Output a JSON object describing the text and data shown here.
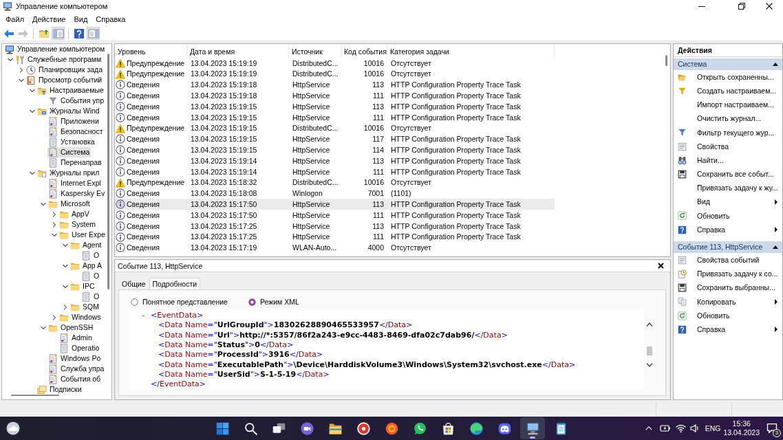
{
  "window": {
    "title": "Управление компьютером"
  },
  "menu": [
    "Файл",
    "Действие",
    "Вид",
    "Справка"
  ],
  "toolbar": [
    {
      "kind": "back",
      "disabled": false,
      "pressed": false
    },
    {
      "kind": "forward",
      "disabled": true,
      "pressed": false
    },
    {
      "kind": "separator"
    },
    {
      "kind": "up",
      "disabled": false,
      "pressed": false
    },
    {
      "kind": "tree",
      "disabled": false,
      "pressed": true
    },
    {
      "kind": "separator"
    },
    {
      "kind": "help",
      "disabled": false,
      "pressed": false
    },
    {
      "kind": "actions",
      "disabled": false,
      "pressed": true
    }
  ],
  "tree": [
    {
      "label": "Управление компьютером",
      "kind": "computer",
      "selected": false,
      "children": [
        {
          "label": "Служебные программ",
          "kind": "tools",
          "expanded": true,
          "selected": false,
          "children": [
            {
              "label": "Планировщик зада",
              "kind": "clock",
              "expanded": false,
              "selected": false
            },
            {
              "label": "Просмотр событий",
              "kind": "viewer",
              "expanded": true,
              "selected": false,
              "children": [
                {
                  "label": "Настраиваемые",
                  "kind": "filterfolder",
                  "expanded": true,
                  "selected": false,
                  "children": [
                    {
                      "label": "События упр",
                      "kind": "funnel",
                      "selected": false
                    }
                  ]
                },
                {
                  "label": "Журналы Wind",
                  "kind": "logfolder",
                  "expanded": true,
                  "selected": false,
                  "children": [
                    {
                      "label": "Приложени",
                      "kind": "eventlog",
                      "selected": false
                    },
                    {
                      "label": "Безопасност",
                      "kind": "eventlog",
                      "selected": false
                    },
                    {
                      "label": "Установка",
                      "kind": "plainlog",
                      "selected": false
                    },
                    {
                      "label": "Система",
                      "kind": "eventlog",
                      "selected": true
                    },
                    {
                      "label": "Перенаправ",
                      "kind": "plainlog",
                      "selected": false
                    }
                  ]
                },
                {
                  "label": "Журналы прил",
                  "kind": "appfolder",
                  "expanded": true,
                  "selected": false,
                  "children": [
                    {
                      "label": "Internet Expl",
                      "kind": "eventlog",
                      "selected": false
                    },
                    {
                      "label": "Kaspersky Ev",
                      "kind": "eventlog",
                      "selected": false
                    },
                    {
                      "label": "Microsoft",
                      "kind": "folder",
                      "expanded": true,
                      "selected": false,
                      "children": [
                        {
                          "label": "AppV",
                          "kind": "folder",
                          "expanded": false,
                          "selected": false
                        },
                        {
                          "label": "System",
                          "kind": "folder",
                          "expanded": false,
                          "selected": false
                        },
                        {
                          "label": "User Expe",
                          "kind": "folder",
                          "expanded": true,
                          "selected": false,
                          "children": [
                            {
                              "label": "Agent",
                              "kind": "folder",
                              "expanded": true,
                              "selected": false,
                              "children": [
                                {
                                  "label": "O",
                                  "kind": "plainlog",
                                  "selected": false
                                }
                              ]
                            },
                            {
                              "label": "App A",
                              "kind": "folder",
                              "expanded": true,
                              "selected": false,
                              "children": [
                                {
                                  "label": "O",
                                  "kind": "plainlog",
                                  "selected": false
                                }
                              ]
                            },
                            {
                              "label": "IPC",
                              "kind": "folder",
                              "expanded": true,
                              "selected": false,
                              "children": [
                                {
                                  "label": "O",
                                  "kind": "plainlog",
                                  "selected": false
                                }
                              ]
                            },
                            {
                              "label": "SQM",
                              "kind": "folder",
                              "expanded": false,
                              "selected": false
                            }
                          ]
                        },
                        {
                          "label": "Windows",
                          "kind": "folder",
                          "expanded": false,
                          "selected": false
                        }
                      ]
                    },
                    {
                      "label": "OpenSSH",
                      "kind": "folder",
                      "expanded": true,
                      "selected": false,
                      "children": [
                        {
                          "label": "Admin",
                          "kind": "eventlog",
                          "selected": false
                        },
                        {
                          "label": "Operatio",
                          "kind": "plainlog",
                          "selected": false
                        }
                      ]
                    },
                    {
                      "label": "Windows Po",
                      "kind": "eventlog",
                      "selected": false
                    },
                    {
                      "label": "Служба упра",
                      "kind": "eventlog",
                      "selected": false
                    },
                    {
                      "label": "События об",
                      "kind": "eventlog",
                      "selected": false
                    }
                  ]
                },
                {
                  "label": "Подписки",
                  "kind": "subscriptions",
                  "selected": false
                }
              ]
            }
          ]
        }
      ]
    }
  ],
  "events": {
    "columns": [
      "Уровень",
      "Дата и время",
      "Источник",
      "Код события",
      "Категория задачи"
    ],
    "rows": [
      {
        "kind": "warning",
        "severity": "Предупреждение",
        "date": "13.04.2023 15:19:19",
        "source": "DistributedC...",
        "event_id": "10016",
        "category": "Отсутствует",
        "selected": false
      },
      {
        "kind": "warning",
        "severity": "Предупреждение",
        "date": "13.04.2023 15:19:19",
        "source": "DistributedC...",
        "event_id": "10016",
        "category": "Отсутствует",
        "selected": false
      },
      {
        "kind": "info",
        "severity": "Сведения",
        "date": "13.04.2023 15:19:18",
        "source": "HttpService",
        "event_id": "113",
        "category": "HTTP Configuration Property Trace Task",
        "selected": false
      },
      {
        "kind": "info",
        "severity": "Сведения",
        "date": "13.04.2023 15:19:18",
        "source": "HttpService",
        "event_id": "111",
        "category": "HTTP Configuration Property Trace Task",
        "selected": false
      },
      {
        "kind": "info",
        "severity": "Сведения",
        "date": "13.04.2023 15:19:15",
        "source": "HttpService",
        "event_id": "113",
        "category": "HTTP Configuration Property Trace Task",
        "selected": false
      },
      {
        "kind": "info",
        "severity": "Сведения",
        "date": "13.04.2023 15:19:15",
        "source": "HttpService",
        "event_id": "111",
        "category": "HTTP Configuration Property Trace Task",
        "selected": false
      },
      {
        "kind": "warning",
        "severity": "Предупреждение",
        "date": "13.04.2023 15:19:15",
        "source": "DistributedC...",
        "event_id": "10016",
        "category": "Отсутствует",
        "selected": false
      },
      {
        "kind": "info",
        "severity": "Сведения",
        "date": "13.04.2023 15:19:15",
        "source": "HttpService",
        "event_id": "117",
        "category": "HTTP Configuration Property Trace Task",
        "selected": false
      },
      {
        "kind": "info",
        "severity": "Сведения",
        "date": "13.04.2023 15:19:15",
        "source": "HttpService",
        "event_id": "114",
        "category": "HTTP Configuration Property Trace Task",
        "selected": false
      },
      {
        "kind": "info",
        "severity": "Сведения",
        "date": "13.04.2023 15:19:14",
        "source": "HttpService",
        "event_id": "113",
        "category": "HTTP Configuration Property Trace Task",
        "selected": false
      },
      {
        "kind": "info",
        "severity": "Сведения",
        "date": "13.04.2023 15:19:14",
        "source": "HttpService",
        "event_id": "111",
        "category": "HTTP Configuration Property Trace Task",
        "selected": false
      },
      {
        "kind": "warning",
        "severity": "Предупреждение",
        "date": "13.04.2023 15:18:32",
        "source": "DistributedC...",
        "event_id": "10016",
        "category": "Отсутствует",
        "selected": false
      },
      {
        "kind": "info",
        "severity": "Сведения",
        "date": "13.04.2023 15:18:08",
        "source": "Winlogon",
        "event_id": "7001",
        "category": "(1101)",
        "selected": false
      },
      {
        "kind": "info",
        "severity": "Сведения",
        "date": "13.04.2023 15:17:50",
        "source": "HttpService",
        "event_id": "113",
        "category": "HTTP Configuration Property Trace Task",
        "selected": true
      },
      {
        "kind": "info",
        "severity": "Сведения",
        "date": "13.04.2023 15:17:50",
        "source": "HttpService",
        "event_id": "111",
        "category": "HTTP Configuration Property Trace Task",
        "selected": false
      },
      {
        "kind": "info",
        "severity": "Сведения",
        "date": "13.04.2023 15:17:25",
        "source": "HttpService",
        "event_id": "113",
        "category": "HTTP Configuration Property Trace Task",
        "selected": false
      },
      {
        "kind": "info",
        "severity": "Сведения",
        "date": "13.04.2023 15:17:25",
        "source": "HttpService",
        "event_id": "111",
        "category": "HTTP Configuration Property Trace Task",
        "selected": false
      },
      {
        "kind": "info",
        "severity": "Сведения",
        "date": "13.04.2023 15:17:19",
        "source": "WLAN-Auto...",
        "event_id": "4000",
        "category": "Отсутствует",
        "selected": false
      }
    ]
  },
  "details": {
    "title": "Событие 113, HttpService",
    "tabs": [
      {
        "label": "Общие",
        "selected": false
      },
      {
        "label": "Подробности",
        "selected": true
      }
    ],
    "view_modes": [
      {
        "label": "Понятное представление",
        "selected": false
      },
      {
        "label": "Режим XML",
        "selected": true
      }
    ],
    "xml": {
      "toggle": "-",
      "expanded": true,
      "parts": [
        {
          "kind": "punct",
          "text": "<"
        },
        {
          "kind": "tag",
          "text": "EventData"
        },
        {
          "kind": "punct",
          "text": ">"
        }
      ],
      "children": [
        {
          "parts": [
            {
              "kind": "punct",
              "text": "<"
            },
            {
              "kind": "tag",
              "text": "Data"
            },
            {
              "kind": "attr",
              "text": " Name"
            },
            {
              "kind": "punct",
              "text": "=\""
            },
            {
              "kind": "value",
              "text": "UrlGroupId"
            },
            {
              "kind": "punct",
              "text": "\">"
            },
            {
              "kind": "value",
              "text": "18302628890465533957"
            },
            {
              "kind": "punct",
              "text": "</"
            },
            {
              "kind": "tag",
              "text": "Data"
            },
            {
              "kind": "punct",
              "text": ">"
            }
          ]
        },
        {
          "parts": [
            {
              "kind": "punct",
              "text": "<"
            },
            {
              "kind": "tag",
              "text": "Data"
            },
            {
              "kind": "attr",
              "text": " Name"
            },
            {
              "kind": "punct",
              "text": "=\""
            },
            {
              "kind": "value",
              "text": "Url"
            },
            {
              "kind": "punct",
              "text": "\">"
            },
            {
              "kind": "value",
              "text": "http://*:5357/86f2a243-e9cc-4483-8469-dfa02c7dab96/"
            },
            {
              "kind": "punct",
              "text": "</"
            },
            {
              "kind": "tag",
              "text": "Data"
            },
            {
              "kind": "punct",
              "text": ">"
            }
          ]
        },
        {
          "parts": [
            {
              "kind": "punct",
              "text": "<"
            },
            {
              "kind": "tag",
              "text": "Data"
            },
            {
              "kind": "attr",
              "text": " Name"
            },
            {
              "kind": "punct",
              "text": "=\""
            },
            {
              "kind": "value",
              "text": "Status"
            },
            {
              "kind": "punct",
              "text": "\">"
            },
            {
              "kind": "value",
              "text": "0"
            },
            {
              "kind": "punct",
              "text": "</"
            },
            {
              "kind": "tag",
              "text": "Data"
            },
            {
              "kind": "punct",
              "text": ">"
            }
          ]
        },
        {
          "parts": [
            {
              "kind": "punct",
              "text": "<"
            },
            {
              "kind": "tag",
              "text": "Data"
            },
            {
              "kind": "attr",
              "text": " Name"
            },
            {
              "kind": "punct",
              "text": "=\""
            },
            {
              "kind": "value",
              "text": "ProcessId"
            },
            {
              "kind": "punct",
              "text": "\">"
            },
            {
              "kind": "value",
              "text": "3916"
            },
            {
              "kind": "punct",
              "text": "</"
            },
            {
              "kind": "tag",
              "text": "Data"
            },
            {
              "kind": "punct",
              "text": ">"
            }
          ]
        },
        {
          "parts": [
            {
              "kind": "punct",
              "text": "<"
            },
            {
              "kind": "tag",
              "text": "Data"
            },
            {
              "kind": "attr",
              "text": " Name"
            },
            {
              "kind": "punct",
              "text": "=\""
            },
            {
              "kind": "value",
              "text": "ExecutablePath"
            },
            {
              "kind": "punct",
              "text": "\">"
            },
            {
              "kind": "value",
              "text": "\\Device\\HarddiskVolume3\\Windows\\System32\\svchost.exe"
            },
            {
              "kind": "punct",
              "text": "</"
            },
            {
              "kind": "tag",
              "text": "Data"
            },
            {
              "kind": "punct",
              "text": ">"
            }
          ]
        },
        {
          "parts": [
            {
              "kind": "punct",
              "text": "<"
            },
            {
              "kind": "tag",
              "text": "Data"
            },
            {
              "kind": "attr",
              "text": " Name"
            },
            {
              "kind": "punct",
              "text": "=\""
            },
            {
              "kind": "value",
              "text": "UserSid"
            },
            {
              "kind": "punct",
              "text": "\">"
            },
            {
              "kind": "value",
              "text": "S-1-5-19"
            },
            {
              "kind": "punct",
              "text": "</"
            },
            {
              "kind": "tag",
              "text": "Data"
            },
            {
              "kind": "punct",
              "text": ">"
            }
          ]
        }
      ],
      "end_parts": [
        {
          "kind": "punct",
          "text": "</"
        },
        {
          "kind": "tag",
          "text": "EventData"
        },
        {
          "kind": "punct",
          "text": ">"
        }
      ]
    }
  },
  "actions": {
    "title": "Действия",
    "sections": [
      {
        "title": "Система",
        "expanded": true,
        "items": [
          {
            "label": "Открыть сохраненны...",
            "kind": "open",
            "submenu": false
          },
          {
            "label": "Создать настраиваем...",
            "kind": "newfilter",
            "submenu": false
          },
          {
            "label": "Импорт настраиваем...",
            "kind": "plain",
            "submenu": false
          },
          {
            "label": "Очистить журнал...",
            "kind": "plain",
            "submenu": false
          },
          {
            "label": "Фильтр текущего жур...",
            "kind": "filter",
            "submenu": false
          },
          {
            "label": "Свойства",
            "kind": "properties",
            "submenu": false
          },
          {
            "label": "Найти...",
            "kind": "find",
            "submenu": false
          },
          {
            "label": "Сохранить все событ...",
            "kind": "save",
            "submenu": false
          },
          {
            "label": "Привязать задачу к жу...",
            "kind": "plain",
            "submenu": false
          },
          {
            "label": "Вид",
            "kind": "plain",
            "submenu": true
          },
          {
            "label": "Обновить",
            "kind": "refresh",
            "submenu": false
          },
          {
            "label": "Справка",
            "kind": "help",
            "submenu": true
          }
        ]
      },
      {
        "title": "Событие 113, HttpService",
        "expanded": true,
        "items": [
          {
            "label": "Свойства событий",
            "kind": "properties",
            "submenu": false
          },
          {
            "label": "Привязать задачу к со...",
            "kind": "task",
            "submenu": false
          },
          {
            "label": "Сохранить выбранны...",
            "kind": "save",
            "submenu": false
          },
          {
            "label": "Копировать",
            "kind": "copy",
            "submenu": true
          },
          {
            "label": "Обновить",
            "kind": "refresh",
            "submenu": false
          },
          {
            "label": "Справка",
            "kind": "help",
            "submenu": true
          }
        ]
      }
    ]
  },
  "taskbar": {
    "apps": [
      {
        "kind": "start",
        "selected": false
      },
      {
        "kind": "search",
        "selected": false
      },
      {
        "kind": "taskview",
        "selected": false
      },
      {
        "kind": "videochat",
        "selected": false
      },
      {
        "kind": "folder",
        "selected": false
      },
      {
        "kind": "browser",
        "selected": false
      },
      {
        "kind": "player",
        "selected": false
      },
      {
        "kind": "messenger",
        "selected": false
      },
      {
        "kind": "store",
        "selected": false
      },
      {
        "kind": "swirl",
        "selected": false
      },
      {
        "kind": "gamechat",
        "selected": false
      },
      {
        "kind": "console",
        "selected": true
      },
      {
        "kind": "notepad",
        "selected": false
      }
    ],
    "language": "ENG",
    "time": "15:36",
    "date": "13.04.2023",
    "notifications": "3"
  }
}
